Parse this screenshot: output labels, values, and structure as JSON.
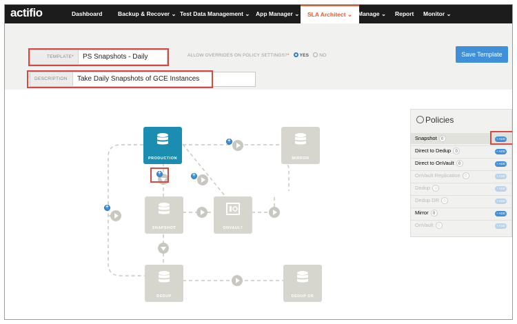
{
  "brand": {
    "logo": "actifio"
  },
  "nav": {
    "items": [
      {
        "label": "Dashboard"
      },
      {
        "label": "Backup & Recover ⌄"
      },
      {
        "label": "Test Data Management ⌄"
      },
      {
        "label": "App Manager ⌄"
      },
      {
        "label": "SLA Architect ⌄",
        "active": true
      },
      {
        "label": "Manage ⌄"
      },
      {
        "label": "Report"
      },
      {
        "label": "Monitor ⌄"
      }
    ]
  },
  "template": {
    "template_label": "TEMPLATE",
    "template_required": "*",
    "template_value": "PS Snapshots - Daily",
    "description_label": "DESCRIPTION",
    "description_value": "Take Daily Snapshots of GCE Instances",
    "overrides_label": "ALLOW OVERRIDES ON POLICY SETTINGS?",
    "overrides_required": "*",
    "overrides_yes": "YES",
    "overrides_no": "NO",
    "overrides_selected": "YES",
    "save_label": "Save Template"
  },
  "workflow": {
    "nodes": {
      "production": "PRODUCTION",
      "mirror": "MIRROR",
      "snapshot": "SNAPSHOT",
      "onvault": "ONVAULT",
      "dedup": "DEDUP",
      "dedup_dr": "DEDUP DR"
    }
  },
  "policies": {
    "title": "Policies",
    "add_label": "+ ADD",
    "items": [
      {
        "name": "Snapshot",
        "count": "0",
        "enabled": true
      },
      {
        "name": "Direct to Dedup",
        "count": "0",
        "enabled": true
      },
      {
        "name": "Direct to OnVault",
        "count": "0",
        "enabled": true
      },
      {
        "name": "OnVault Replication",
        "count": "0",
        "enabled": false
      },
      {
        "name": "Dedup",
        "count": "0",
        "enabled": false
      },
      {
        "name": "Dedup DR",
        "count": "0",
        "enabled": false
      },
      {
        "name": "Mirror",
        "count": "0",
        "enabled": true
      },
      {
        "name": "OnVault",
        "count": "0",
        "enabled": false
      }
    ]
  },
  "colors": {
    "nav_bg": "#1c1c1c",
    "accent": "#e85a2a",
    "primary_node": "#1a8db0",
    "button": "#3f8fd9",
    "highlight_box": "#d9473f"
  }
}
